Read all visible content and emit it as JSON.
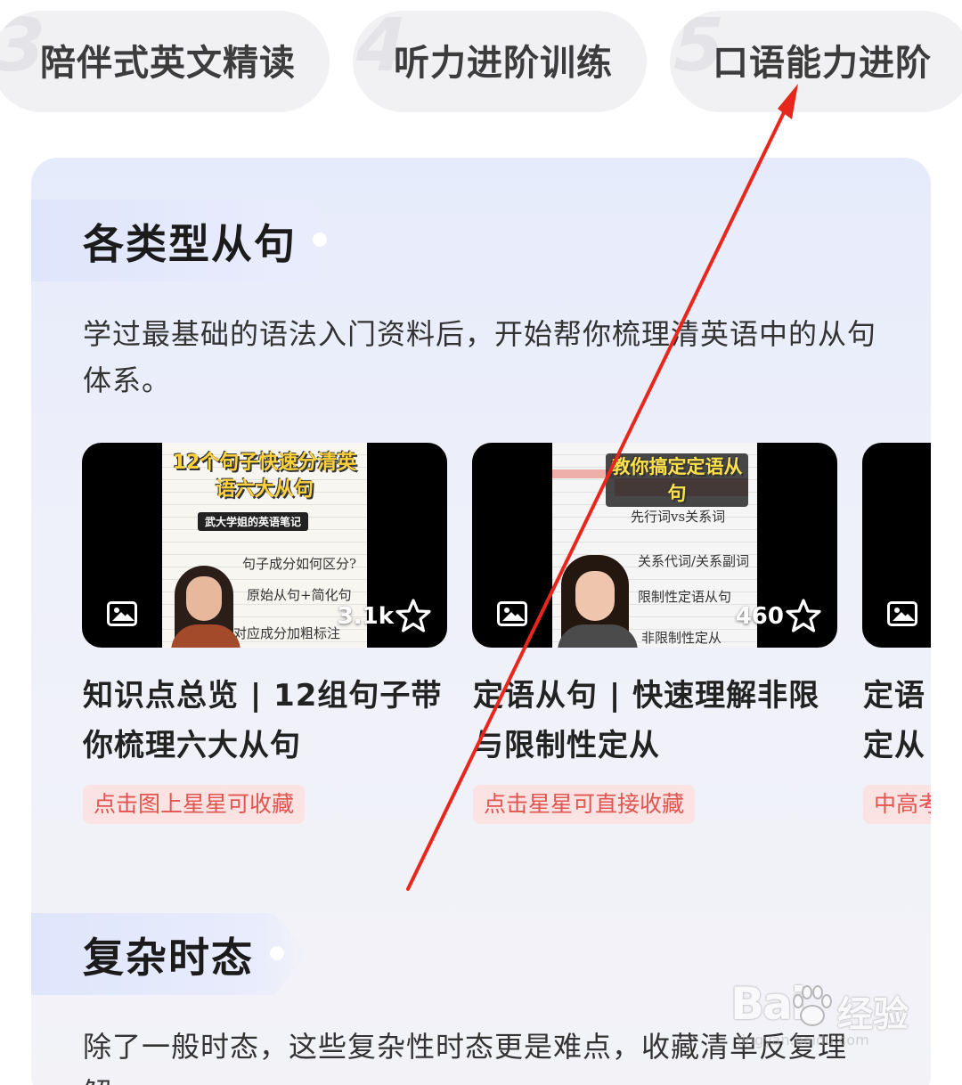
{
  "tabs": [
    {
      "number": "3",
      "label": "陪伴式英文精读"
    },
    {
      "number": "4",
      "label": "听力进阶训练"
    },
    {
      "number": "5",
      "label": "口语能力进阶"
    }
  ],
  "section1": {
    "title": "各类型从句",
    "description": "学过最基础的语法入门资料后，开始帮你梳理清英语中的从句体系。",
    "videos": [
      {
        "thumb_banner": "12个句子快速分清英语六大从句",
        "thumb_sub": "武大学姐的英语笔记",
        "thumb_notes": [
          "句子成分如何区分?",
          "原始从句+简化句",
          "对应成分加粗标注"
        ],
        "count": "3.1k",
        "title_line1": "知识点总览 | 12组句子带",
        "title_line2": "你梳理六大从句",
        "tag": "点击图上星星可收藏"
      },
      {
        "thumb_banner": "教你搞定定语从句",
        "thumb_notes": [
          "先行词vs关系词",
          "关系代词/关系副词",
          "限制性定语从句",
          "非限制性定从"
        ],
        "count": "460",
        "title_line1": "定语从句 | 快速理解非限",
        "title_line2": "与限制性定从",
        "tag": "点击星星可直接收藏"
      },
      {
        "title_line1": "定语",
        "title_line2": "定从",
        "tag": "中高考"
      }
    ]
  },
  "section2": {
    "title": "复杂时态",
    "description": "除了一般时态，这些复杂性时态更是难点，收藏清单反复理解。"
  },
  "watermark": {
    "brand": "Bai",
    "brand_suffix": "经验",
    "url": "jingyan.baidu.com"
  },
  "colors": {
    "accent_red": "#e0554f",
    "tag_bg": "#fce3e3",
    "card_bg": "#eef0fa",
    "annotation_arrow": "#e8271c"
  }
}
